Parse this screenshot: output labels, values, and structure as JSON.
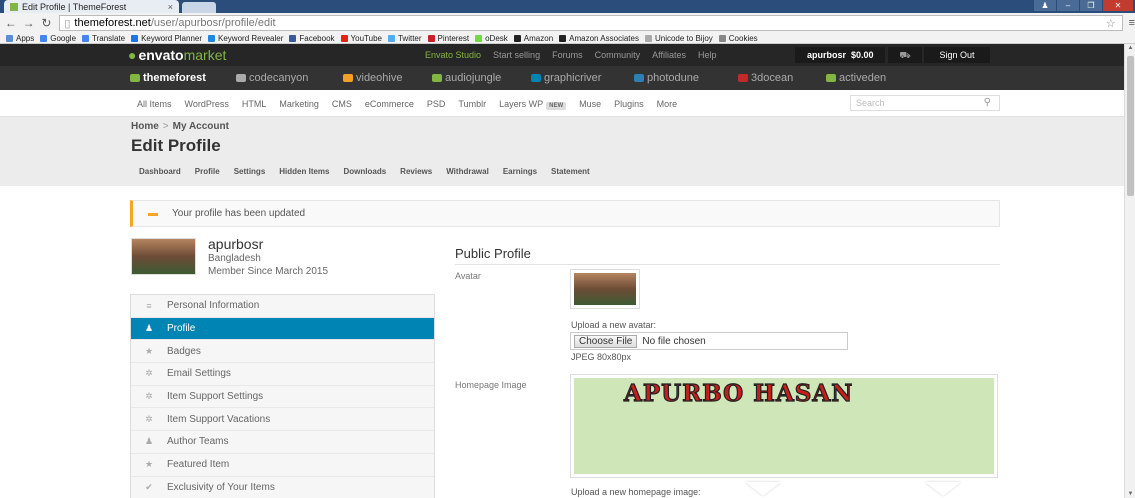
{
  "browser": {
    "tab_title": "Edit Profile | ThemeForest",
    "tab_close": "×",
    "url_host": "themeforest.net",
    "url_path": "/user/apurbosr/profile/edit",
    "bookmarks": [
      {
        "label": "Apps",
        "color": "#5a8fd6"
      },
      {
        "label": "Google",
        "color": "#4285f4"
      },
      {
        "label": "Translate",
        "color": "#4285f4"
      },
      {
        "label": "Keyword Planner",
        "color": "#1a73e8"
      },
      {
        "label": "Keyword Revealer",
        "color": "#1e88e5"
      },
      {
        "label": "Facebook",
        "color": "#3b5998"
      },
      {
        "label": "YouTube",
        "color": "#e62117"
      },
      {
        "label": "Twitter",
        "color": "#55acee"
      },
      {
        "label": "Pinterest",
        "color": "#cb2027"
      },
      {
        "label": "oDesk",
        "color": "#6fda44"
      },
      {
        "label": "Amazon",
        "color": "#222"
      },
      {
        "label": "Amazon Associates",
        "color": "#222"
      },
      {
        "label": "Unicode to Bijoy",
        "color": "#aaa"
      },
      {
        "label": "Cookies",
        "color": "#888"
      }
    ]
  },
  "envato": {
    "logo": "envato",
    "logo_suffix": "market",
    "topnav": [
      "Envato Studio",
      "Start selling",
      "Forums",
      "Community",
      "Affiliates",
      "Help"
    ],
    "user": "apurbosr",
    "balance": "$0.00",
    "cart_icon": "cart-icon",
    "signout": "Sign Out"
  },
  "marketplaces": [
    {
      "label": "themeforest",
      "color": "#82b541"
    },
    {
      "label": "codecanyon",
      "color": "#aaa"
    },
    {
      "label": "videohive",
      "color": "#f4a024"
    },
    {
      "label": "audiojungle",
      "color": "#82b541"
    },
    {
      "label": "graphicriver",
      "color": "#0084b4"
    },
    {
      "label": "photodune",
      "color": "#2d7fb5"
    },
    {
      "label": "3docean",
      "color": "#c22a2a"
    },
    {
      "label": "activeden",
      "color": "#82b541"
    }
  ],
  "categories": [
    "All Items",
    "WordPress",
    "HTML",
    "Marketing",
    "CMS",
    "eCommerce",
    "PSD",
    "Tumblr",
    "Layers WP",
    "Muse",
    "Plugins",
    "More"
  ],
  "new_badge": "NEW",
  "search_placeholder": "Search",
  "breadcrumb": {
    "home": "Home",
    "sep": ">",
    "account": "My Account"
  },
  "page_title": "Edit Profile",
  "subtabs": [
    "Dashboard",
    "Profile",
    "Settings",
    "Hidden Items",
    "Downloads",
    "Reviews",
    "Withdrawal",
    "Earnings",
    "Statement"
  ],
  "notification": "Your profile has been updated",
  "profile": {
    "username": "apurbosr",
    "country": "Bangladesh",
    "member_since": "Member Since March 2015"
  },
  "sidemenu": [
    {
      "label": "Personal Information",
      "icon": "≡"
    },
    {
      "label": "Profile",
      "icon": "♟"
    },
    {
      "label": "Badges",
      "icon": "★"
    },
    {
      "label": "Email Settings",
      "icon": "✲"
    },
    {
      "label": "Item Support Settings",
      "icon": "✲"
    },
    {
      "label": "Item Support Vacations",
      "icon": "✲"
    },
    {
      "label": "Author Teams",
      "icon": "♟"
    },
    {
      "label": "Featured Item",
      "icon": "★"
    },
    {
      "label": "Exclusivity of Your Items",
      "icon": "✔"
    }
  ],
  "form": {
    "section_title": "Public Profile",
    "avatar_label": "Avatar",
    "upload_avatar": "Upload a new avatar:",
    "choose_file": "Choose File",
    "no_file": "No file chosen",
    "avatar_spec": "JPEG 80x80px",
    "homepage_label": "Homepage Image",
    "homepage_text": "APURBO HASAN",
    "upload_homepage": "Upload a new homepage image:"
  },
  "colors": {
    "accent_blue": "#0084b4",
    "envato_green": "#82b541",
    "notice": "#f5a623"
  }
}
